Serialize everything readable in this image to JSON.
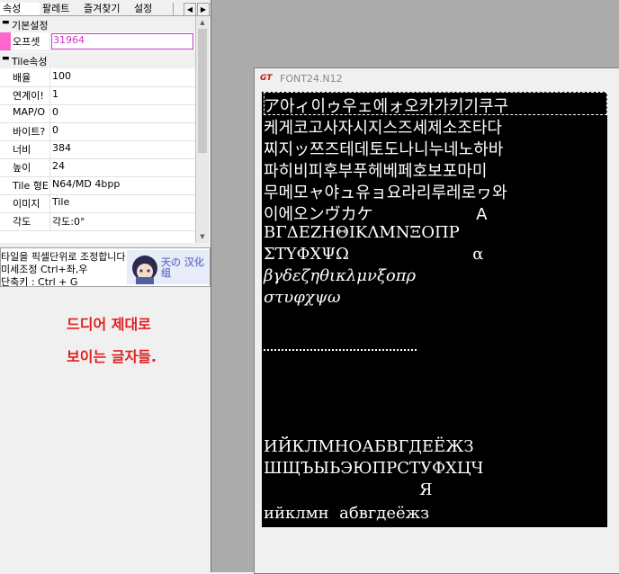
{
  "tabs": [
    "속성",
    "팔레트",
    "즐겨찾기",
    "설정"
  ],
  "props": {
    "cat1": "기본설정",
    "offset_name": "오프셋",
    "offset_value": "31964",
    "cat2": "Tile속성",
    "rows": [
      {
        "name": "배율",
        "value": "100"
      },
      {
        "name": "연계이!",
        "value": "1"
      },
      {
        "name": "MAP/O",
        "value": "0"
      },
      {
        "name": "바이트?",
        "value": "0"
      },
      {
        "name": "너비",
        "value": "384"
      },
      {
        "name": "높이",
        "value": "24"
      },
      {
        "name": "Tile 형E",
        "value": "N64/MD 4bpp"
      },
      {
        "name": "이미지",
        "value": "Tile"
      },
      {
        "name": "각도",
        "value": "각도:0°"
      }
    ]
  },
  "hint": {
    "line1": "타일을 픽셀단위로 조정합니다",
    "line2": "미세조정 Ctrl+좌,우",
    "line3": "단축키 : Ctrl + G",
    "mascot": "天の 汉化组"
  },
  "caption": {
    "line1": "드디어 제대로",
    "line2": "보이는 글자들."
  },
  "window": {
    "logo": "GT",
    "title": "FONT24.N12"
  },
  "glyph_lines": [
    "ア아ィ이ゥ우ェ에ォ오카가키기쿠구",
    "케게코고사자시지스즈세제소조타다",
    "찌지ッ쯔즈테데토도나니누네노하바",
    "파히비피후부푸헤베페호보포마미",
    "무메모ャ야ュ유ョ요라리루레로ヮ와",
    "이에오ンヴカケ                    A",
    "ΒΓΔΕΖΗΘΙΚΛΜΝΞΟΠΡ",
    "ΣΤΥΦΧΨΩ                        α",
    "βγδεζηθικλμνξοπρ",
    "στυφχψω",
    "ИЙКЛМНОАБВГДЕЁЖЗ",
    "ШЩЪЫЬЭЮПРСТУФХЦЧ",
    "Я",
    "ийклмн  абвгдеёжз"
  ],
  "colors": {
    "offset_marker": "#ff66cc",
    "offset_text": "#cc33cc",
    "caption": "#e02020"
  }
}
